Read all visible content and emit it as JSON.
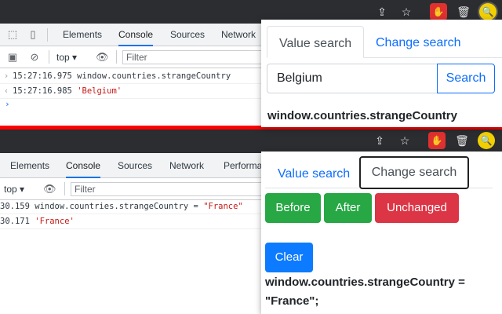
{
  "devtools": {
    "tabs": [
      "Elements",
      "Console",
      "Sources",
      "Network"
    ],
    "tabs_bottom": [
      "Elements",
      "Console",
      "Sources",
      "Network",
      "Performa"
    ],
    "context": "top",
    "filter_placeholder": "Filter"
  },
  "top": {
    "logs": [
      {
        "text": "15:27:16.975 window.countries.strangeCountry",
        "str": ""
      },
      {
        "text": "15:27:16.985 ",
        "str": "'Belgium'"
      }
    ],
    "popup": {
      "tab_value": "Value search",
      "tab_change": "Change search",
      "search_value": "Belgium",
      "search_button": "Search",
      "result": "window.countries.strangeCountry"
    }
  },
  "bottom": {
    "logs": [
      {
        "text": "30.159 window.countries.strangeCountry = ",
        "str": "\"France\""
      },
      {
        "text": "30.171 ",
        "str": "'France'"
      }
    ],
    "popup": {
      "tab_value": "Value search",
      "tab_change": "Change search",
      "btn_before": "Before",
      "btn_after": "After",
      "btn_unchanged": "Unchanged",
      "btn_clear": "Clear",
      "result_line1": "window.countries.strangeCountry =",
      "result_line2": "\"France\";"
    }
  },
  "colors": {
    "separator": "#ff0000",
    "accent": "#0d6efd",
    "green": "#28a745",
    "red": "#dc3545"
  }
}
